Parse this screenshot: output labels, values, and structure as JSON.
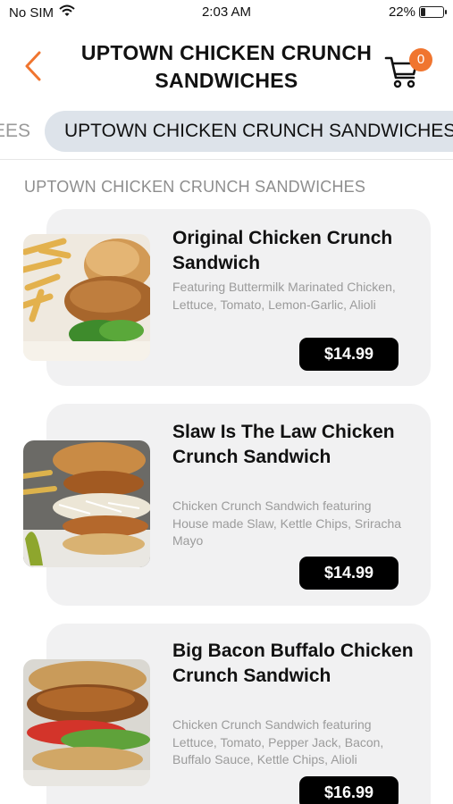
{
  "status_bar": {
    "carrier": "No SIM",
    "time": "2:03 AM",
    "battery_text": "22%",
    "battery_level": 0.22
  },
  "header": {
    "title": "UPTOWN CHICKEN CRUNCH SANDWICHES",
    "cart_count": "0"
  },
  "tabs": [
    {
      "label": "EES",
      "active": false
    },
    {
      "label": "UPTOWN CHICKEN CRUNCH SANDWICHES",
      "active": true
    }
  ],
  "section_title": "UPTOWN CHICKEN CRUNCH SANDWICHES",
  "items": [
    {
      "name": "Original Chicken Crunch Sandwich",
      "description": "Featuring Buttermilk Marinated Chicken, Lettuce, Tomato, Lemon-Garlic, Alioli",
      "price": "$14.99"
    },
    {
      "name": "Slaw Is The Law Chicken Crunch Sandwich",
      "description": "Chicken Crunch Sandwich featuring House made Slaw, Kettle Chips, Sriracha Mayo",
      "price": "$14.99"
    },
    {
      "name": "Big Bacon Buffalo Chicken Crunch Sandwich",
      "description": "Chicken Crunch Sandwich featuring Lettuce, Tomato, Pepper Jack, Bacon, Buffalo Sauce, Kettle Chips, Alioli",
      "price": "$16.99"
    }
  ],
  "colors": {
    "accent": "#f0752f",
    "tab_active_bg": "#dde3ea",
    "card_bg": "#f1f1f2",
    "price_bg": "#000000"
  },
  "icons": {
    "back": "chevron-left-icon",
    "cart": "cart-icon",
    "wifi": "wifi-icon",
    "battery": "battery-icon"
  }
}
